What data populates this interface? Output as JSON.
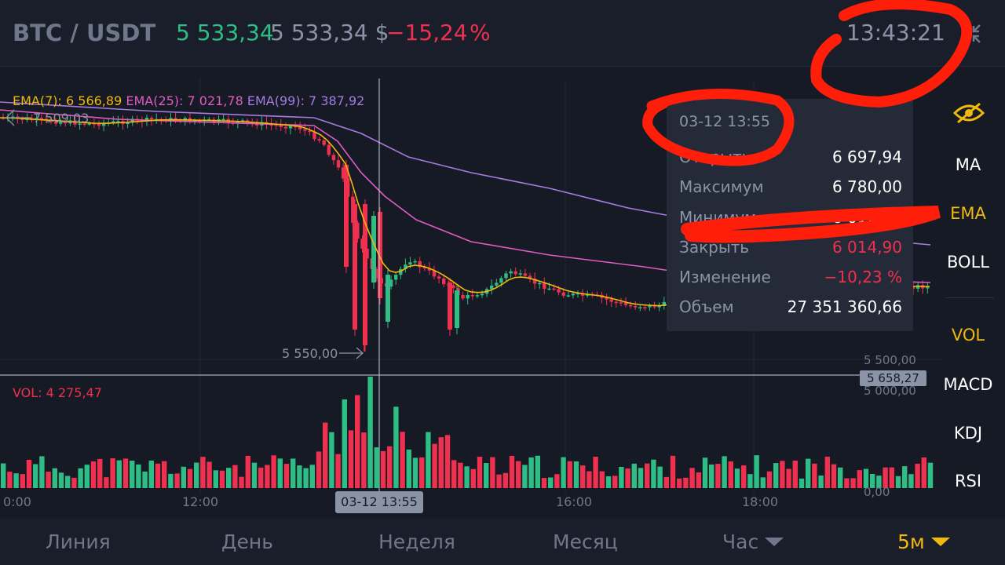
{
  "header": {
    "pair": "BTC / USDT",
    "last_price": "5 533,34",
    "usd_price": "5 533,34 $",
    "change": "−15,24",
    "change_unit": "%",
    "time": "13:43:21",
    "collapse_icon": "collapse-arrows-icon"
  },
  "legend": {
    "ema7": "EMA(7): 6 566,89",
    "ema25": "EMA(25): 7 021,78",
    "ema99": "EMA(99): 7 387,92",
    "high_marker": "7 509,03",
    "low_marker": "5 550,00",
    "vol": "VOL: 4 275,47"
  },
  "axis": {
    "y_labels": [
      "5 500,00",
      "5 000,00",
      "0,00"
    ],
    "y_cursor": "5 658,27",
    "x_labels": [
      "0:00",
      "12:00",
      "16:00",
      "18:00"
    ],
    "x_cursor": "03-12 13:55"
  },
  "tooltip": {
    "date": "03-12 13:55",
    "rows": [
      {
        "label": "Открыть",
        "value": "6 697,94"
      },
      {
        "label": "Максимум",
        "value": "6 780,00"
      },
      {
        "label": "Минимум",
        "value": "6 012,50"
      },
      {
        "label": "Закрыть",
        "value": "6 014,90"
      },
      {
        "label": "Изменение",
        "value": "−10,23 %"
      },
      {
        "label": "Объем",
        "value": "27 351 360,66"
      }
    ]
  },
  "indicators": {
    "eye_icon": "eye-icon",
    "items": [
      "MA",
      "EMA",
      "BOLL",
      "VOL",
      "MACD",
      "KDJ",
      "RSI"
    ],
    "active": [
      "EMA",
      "VOL"
    ]
  },
  "tabs": {
    "items": [
      "Линия",
      "День",
      "Неделя",
      "Месяц",
      "Час",
      "5м"
    ],
    "active": "5м"
  },
  "colors": {
    "up": "#2ebd85",
    "down": "#f0304f",
    "ema7": "#f0b90b",
    "ema25": "#e05bc2",
    "ema99": "#a87be0",
    "accent": "#f0b90b",
    "scribble": "#ff1e0a"
  }
}
